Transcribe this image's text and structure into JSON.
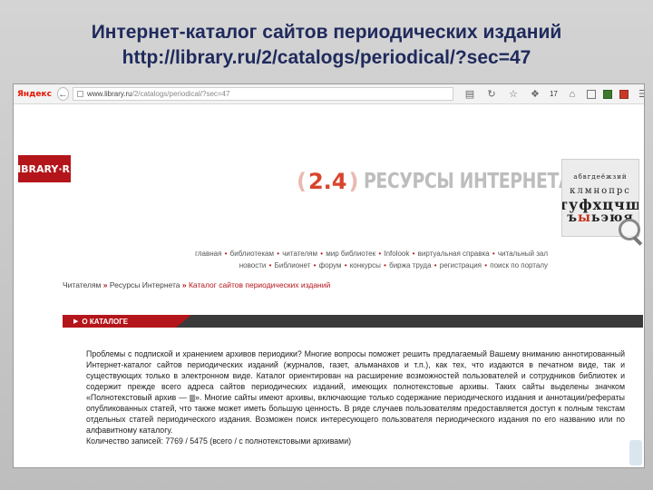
{
  "slide": {
    "title_line1": "Интернет-каталог сайтов периодических изданий",
    "title_line2": "http://library.ru/2/catalogs/periodical/?sec=47"
  },
  "browser": {
    "yandex_label": "Яндекс",
    "url_domain": "www.library.ru",
    "url_path": "/2/catalogs/periodical/?sec=47",
    "notification_count": "17"
  },
  "site": {
    "logo_text": "LIBRARY·RU",
    "section_paren_open": "(",
    "section_number": "2.4",
    "section_paren_close": ")",
    "section_title": "РЕСУРСЫ ИНТЕРНЕТА",
    "font_box": {
      "row1": "абвгдеёжзий",
      "row2": "клмнопрс",
      "row3": "туфхцчш",
      "row4a": "ъ",
      "row4b": "ы",
      "row4c": "ьэюя"
    },
    "nav_row1": [
      "главная",
      "библиотекам",
      "читателям",
      "мир библиотек",
      "Infolook",
      "виртуальная справка",
      "читальный зал"
    ],
    "nav_row2": [
      "новости",
      "Библионет",
      "форум",
      "конкурсы",
      "биржа труда",
      "регистрация",
      "поиск по порталу"
    ],
    "breadcrumb": {
      "item1": "Читателям",
      "item2": "Ресурсы Интернета",
      "current": "Каталог сайтов периодических изданий",
      "separator": "»"
    },
    "section_tab": "О КАТАЛОГЕ",
    "content": {
      "paragraph_start": "Проблемы с подпиской и хранением архивов периодики? Многие вопросы поможет решить предлагаемый Вашему вниманию аннотированный Интернет-каталог сайтов периодических изданий (журналов, газет, альманахов и т.п.), как тех, что издаются в печатном виде, так и существующих только в электронном виде. Каталог ориентирован на расширение возможностей пользователей и сотрудников библиотек и содержит прежде всего адреса сайтов периодических изданий, имеющих полнотекстовые архивы. Таких сайты выделены значком «Полнотекстовый архив —",
      "paragraph_end": "». Многие сайты имеют архивы, включающие только содержание периодического издания и аннотации/рефераты опубликованных статей, что также может иметь большую ценность. В ряде случаев пользователям предоставляется доступ к полным текстам отдельных статей периодического издания. Возможен поиск интересующего пользователя периодического издания по его названию или по алфавитному каталогу.",
      "count_line": "Количество записей: 7769 / 5475 (всего / с полнотекстовыми архивами)"
    }
  }
}
